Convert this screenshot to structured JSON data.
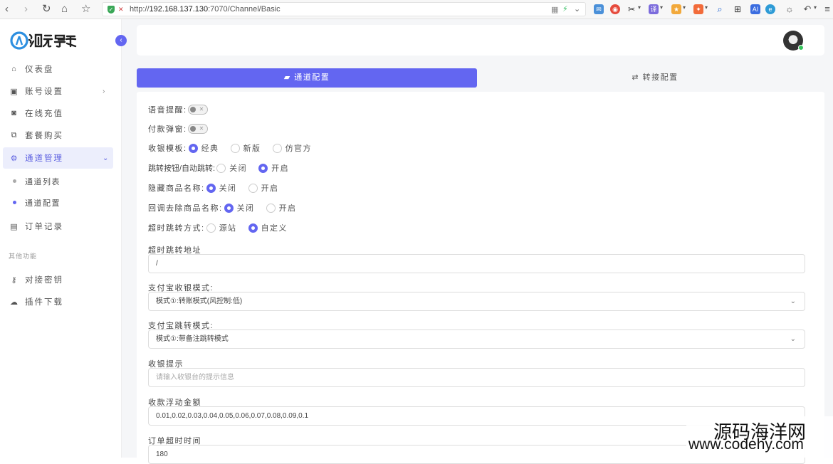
{
  "browser": {
    "url_prefix": "http://",
    "url_host": "192.168.137.130",
    "url_rest": ":7070/Channel/Basic",
    "nav": {
      "back": "‹",
      "forward": "›",
      "reload": "↻",
      "home": "⌂",
      "star": "☆"
    }
  },
  "sidebar": {
    "items": [
      {
        "label": "仪表盘",
        "icon": "home-icon"
      },
      {
        "label": "账号设置",
        "icon": "account-icon"
      },
      {
        "label": "在线充值",
        "icon": "recharge-icon"
      },
      {
        "label": "套餐购买",
        "icon": "package-icon"
      },
      {
        "label": "通道管理",
        "icon": "gear-icon"
      },
      {
        "label": "订单记录",
        "icon": "order-icon"
      }
    ],
    "sub_items": [
      {
        "label": "通道列表"
      },
      {
        "label": "通道配置"
      }
    ],
    "section_label": "其他功能",
    "other_items": [
      {
        "label": "对接密钥",
        "icon": "key-icon"
      },
      {
        "label": "插件下载",
        "icon": "cloud-download-icon"
      }
    ]
  },
  "tabs": [
    {
      "label": "通道配置",
      "icon": "comment-icon"
    },
    {
      "label": "转接配置",
      "icon": "swap-icon"
    }
  ],
  "form": {
    "voice_alert": {
      "label": "语音提醒:"
    },
    "pay_popup": {
      "label": "付款弹窗:"
    },
    "cashier_template": {
      "label": "收银模板:",
      "options": [
        "经典",
        "新版",
        "仿官方"
      ],
      "selected": 0
    },
    "jump_button": {
      "label": "跳转按钮/自动跳转:",
      "options": [
        "关闭",
        "开启"
      ],
      "selected": 1
    },
    "hide_product": {
      "label": "隐藏商品名称:",
      "options": [
        "关闭",
        "开启"
      ],
      "selected": 0
    },
    "callback_remove": {
      "label": "回调去除商品名称:",
      "options": [
        "关闭",
        "开启"
      ],
      "selected": 0
    },
    "timeout_jump": {
      "label": "超时跳转方式:",
      "options": [
        "源站",
        "自定义"
      ],
      "selected": 1
    },
    "timeout_url": {
      "label": "超时跳转地址",
      "value": "/"
    },
    "alipay_cashier": {
      "label": "支付宝收银模式:",
      "value": "模式①:转账模式(风控制:低)"
    },
    "alipay_jump": {
      "label": "支付宝跳转模式:",
      "value": "模式①:带备注跳转模式"
    },
    "cashier_tip": {
      "label": "收银提示",
      "placeholder": "请输入收银台的提示信息"
    },
    "float_amount": {
      "label": "收款浮动金额",
      "value": "0.01,0.02,0.03,0.04,0.05,0.06,0.07,0.08,0.09,0.1"
    },
    "order_timeout": {
      "label": "订单超时时间",
      "value": "180"
    }
  },
  "watermark": {
    "line1": "源码海洋网",
    "line2": "www.codehy.com"
  },
  "colors": {
    "accent": "#6366f1",
    "online": "#35c45b"
  }
}
